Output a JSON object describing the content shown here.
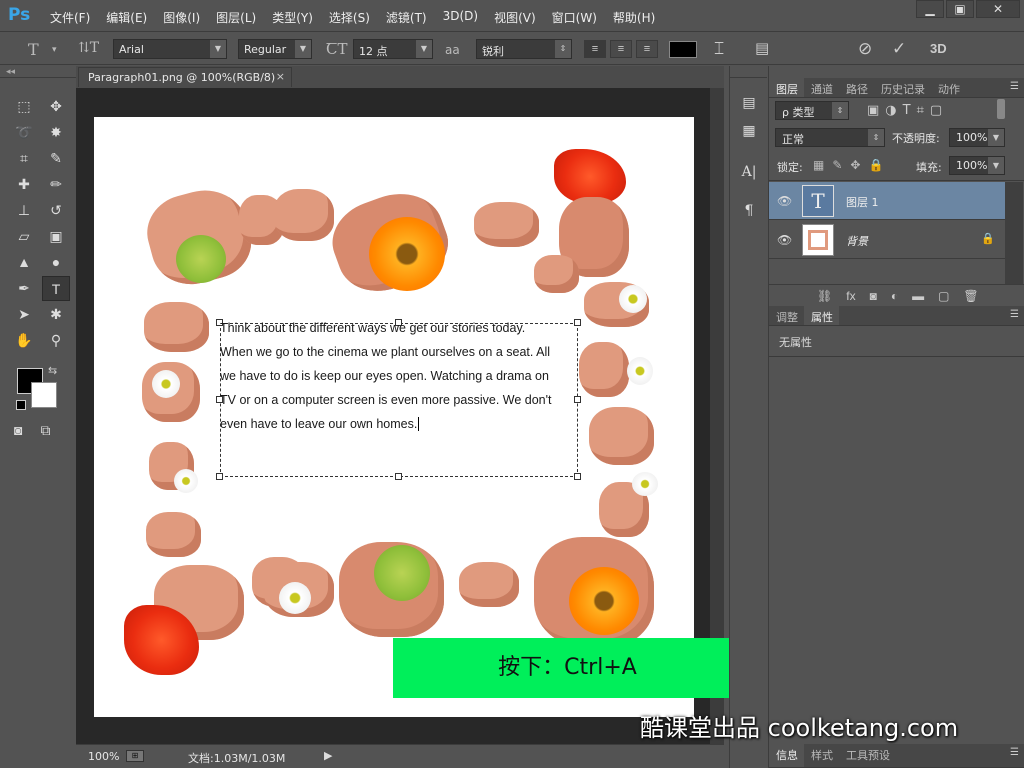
{
  "app": {
    "logo": "Ps"
  },
  "menu": [
    "文件(F)",
    "编辑(E)",
    "图像(I)",
    "图层(L)",
    "类型(Y)",
    "选择(S)",
    "滤镜(T)",
    "3D(D)",
    "视图(V)",
    "窗口(W)",
    "帮助(H)"
  ],
  "window_controls": {
    "minimize": "▁",
    "maximize": "▣",
    "close": "✕"
  },
  "options": {
    "font_family": "Arial",
    "font_style": "Regular",
    "font_size": "12 点",
    "antialias": "锐利",
    "size_icon_label": "aa",
    "color": "#000000"
  },
  "document": {
    "tab_title": "Paragraph01.png @ 100%(RGB/8)",
    "tab_close": "×",
    "paragraph": [
      "Think about the different ways we get our stories today.",
      "When we go to the cinema we plant ourselves on a seat. All",
      "we have to do is keep our eyes open. Watching a drama on",
      "TV or on a computer screen is even more passive. We don't",
      "even have to leave our own homes."
    ]
  },
  "status": {
    "zoom": "100%",
    "doc_size": "文档:1.03M/1.03M"
  },
  "overlays": {
    "hint": "按下：Ctrl+A",
    "watermark": "酷课堂出品 coolketang.com"
  },
  "layers_panel": {
    "tabs": [
      "图层",
      "通道",
      "路径",
      "历史记录",
      "动作"
    ],
    "kind_filter": "ρ 类型",
    "blend_mode": "正常",
    "opacity_label": "不透明度:",
    "opacity": "100%",
    "lock_label": "锁定:",
    "fill_label": "填充:",
    "fill": "100%",
    "layers": [
      {
        "name": "图层 1",
        "thumb": "T",
        "selected": true
      },
      {
        "name": "背景",
        "thumb": "",
        "locked": true
      }
    ]
  },
  "props_panel": {
    "tabs": [
      "调整",
      "属性"
    ],
    "empty_text": "无属性"
  },
  "bottom_tabs": [
    "信息",
    "样式",
    "工具预设"
  ],
  "colors": {
    "foreground": "#000000",
    "background": "#ffffff",
    "hint_bg": "#00ef5a",
    "selected_layer": "#6b86a3"
  }
}
